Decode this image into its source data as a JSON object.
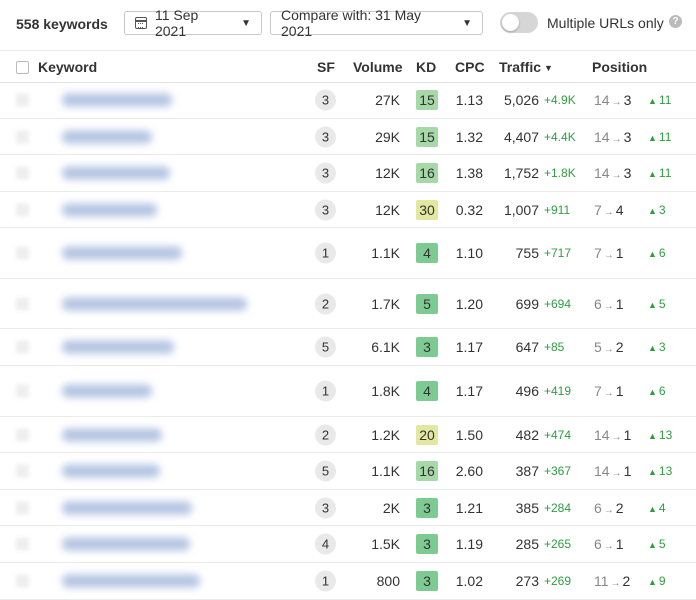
{
  "toolbar": {
    "keyword_count": "558 keywords",
    "date": "11 Sep 2021",
    "compare": "Compare with: 31 May 2021",
    "toggle_label": "Multiple URLs only",
    "help": "?"
  },
  "columns": {
    "keyword": "Keyword",
    "sf": "SF",
    "volume": "Volume",
    "kd": "KD",
    "cpc": "CPC",
    "traffic": "Traffic",
    "position": "Position"
  },
  "colors": {
    "kd_green_light": "#a6d8a8",
    "kd_green": "#7dcb93",
    "kd_yellow": "#e2e8a0",
    "positive": "#2e9e3f"
  },
  "rows": [
    {
      "sf": "3",
      "volume": "27K",
      "kd": "15",
      "kd_color": "#a6d8a8",
      "cpc": "1.13",
      "traffic": "5,026",
      "traffic_delta": "+4.9K",
      "pos_from": "14",
      "pos_to": "3",
      "pos_delta": "11"
    },
    {
      "sf": "3",
      "volume": "29K",
      "kd": "15",
      "kd_color": "#a6d8a8",
      "cpc": "1.32",
      "traffic": "4,407",
      "traffic_delta": "+4.4K",
      "pos_from": "14",
      "pos_to": "3",
      "pos_delta": "11"
    },
    {
      "sf": "3",
      "volume": "12K",
      "kd": "16",
      "kd_color": "#a6d8a8",
      "cpc": "1.38",
      "traffic": "1,752",
      "traffic_delta": "+1.8K",
      "pos_from": "14",
      "pos_to": "3",
      "pos_delta": "11"
    },
    {
      "sf": "3",
      "volume": "12K",
      "kd": "30",
      "kd_color": "#e2e8a0",
      "cpc": "0.32",
      "traffic": "1,007",
      "traffic_delta": "+911",
      "pos_from": "7",
      "pos_to": "4",
      "pos_delta": "3"
    },
    {
      "sf": "1",
      "volume": "1.1K",
      "kd": "4",
      "kd_color": "#7dcb93",
      "cpc": "1.10",
      "traffic": "755",
      "traffic_delta": "+717",
      "pos_from": "7",
      "pos_to": "1",
      "pos_delta": "6"
    },
    {
      "sf": "2",
      "volume": "1.7K",
      "kd": "5",
      "kd_color": "#7dcb93",
      "cpc": "1.20",
      "traffic": "699",
      "traffic_delta": "+694",
      "pos_from": "6",
      "pos_to": "1",
      "pos_delta": "5"
    },
    {
      "sf": "5",
      "volume": "6.1K",
      "kd": "3",
      "kd_color": "#7dcb93",
      "cpc": "1.17",
      "traffic": "647",
      "traffic_delta": "+85",
      "pos_from": "5",
      "pos_to": "2",
      "pos_delta": "3"
    },
    {
      "sf": "1",
      "volume": "1.8K",
      "kd": "4",
      "kd_color": "#7dcb93",
      "cpc": "1.17",
      "traffic": "496",
      "traffic_delta": "+419",
      "pos_from": "7",
      "pos_to": "1",
      "pos_delta": "6"
    },
    {
      "sf": "2",
      "volume": "1.2K",
      "kd": "20",
      "kd_color": "#e2e8a0",
      "cpc": "1.50",
      "traffic": "482",
      "traffic_delta": "+474",
      "pos_from": "14",
      "pos_to": "1",
      "pos_delta": "13"
    },
    {
      "sf": "5",
      "volume": "1.1K",
      "kd": "16",
      "kd_color": "#a6d8a8",
      "cpc": "2.60",
      "traffic": "387",
      "traffic_delta": "+367",
      "pos_from": "14",
      "pos_to": "1",
      "pos_delta": "13"
    },
    {
      "sf": "3",
      "volume": "2K",
      "kd": "3",
      "kd_color": "#7dcb93",
      "cpc": "1.21",
      "traffic": "385",
      "traffic_delta": "+284",
      "pos_from": "6",
      "pos_to": "2",
      "pos_delta": "4"
    },
    {
      "sf": "4",
      "volume": "1.5K",
      "kd": "3",
      "kd_color": "#7dcb93",
      "cpc": "1.19",
      "traffic": "285",
      "traffic_delta": "+265",
      "pos_from": "6",
      "pos_to": "1",
      "pos_delta": "5"
    },
    {
      "sf": "1",
      "volume": "800",
      "kd": "3",
      "kd_color": "#7dcb93",
      "cpc": "1.02",
      "traffic": "273",
      "traffic_delta": "+269",
      "pos_from": "11",
      "pos_to": "2",
      "pos_delta": "9"
    }
  ]
}
